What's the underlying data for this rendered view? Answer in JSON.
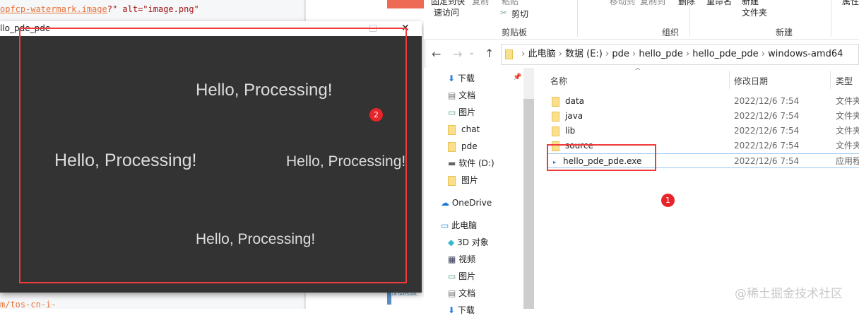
{
  "editor": {
    "line1_link": "opfcp-watermark.image",
    "line1_rest": "?\" alt=\"image.png\"",
    "line2": "m/tos-cn-i-",
    "mini_line_no": "18",
    "mini_code": "textSize("
  },
  "processing_window": {
    "title": "llo_pde_pde",
    "texts": [
      "Hello, Processing!",
      "Hello, Processing!",
      "Hello, Processing!",
      "Hello, Processing!"
    ],
    "badge": "2"
  },
  "ribbon": {
    "top_items": [
      "固定到快",
      "复制",
      "粘贴",
      "移动到",
      "复制到",
      "删除",
      "重命名",
      "新建",
      "属性"
    ],
    "quick_access": "速访问",
    "cut": "剪切",
    "new_folder": "文件夹",
    "groups": [
      "剪贴板",
      "组织",
      "新建"
    ]
  },
  "address": {
    "crumbs": [
      "此电脑",
      "数据 (E:)",
      "pde",
      "hello_pde",
      "hello_pde_pde",
      "windows-amd64"
    ]
  },
  "nav": [
    {
      "label": "下载",
      "icon": "download-icon"
    },
    {
      "label": "文档",
      "icon": "document-icon"
    },
    {
      "label": "图片",
      "icon": "picture-icon"
    },
    {
      "label": "chat",
      "icon": "folder-icon"
    },
    {
      "label": "pde",
      "icon": "folder-icon"
    },
    {
      "label": "软件 (D:)",
      "icon": "drive-icon"
    },
    {
      "label": "图片",
      "icon": "folder-icon"
    },
    {
      "label": "OneDrive",
      "icon": "cloud-icon"
    },
    {
      "label": "此电脑",
      "icon": "computer-icon"
    },
    {
      "label": "3D 对象",
      "icon": "cube-icon"
    },
    {
      "label": "视频",
      "icon": "video-icon"
    },
    {
      "label": "图片",
      "icon": "picture-icon"
    },
    {
      "label": "文档",
      "icon": "document-icon"
    },
    {
      "label": "下载",
      "icon": "download-icon"
    }
  ],
  "columns": {
    "name": "名称",
    "date": "修改日期",
    "type": "类型"
  },
  "files": [
    {
      "name": "data",
      "date": "2022/12/6 7:54",
      "type": "文件夹"
    },
    {
      "name": "java",
      "date": "2022/12/6 7:54",
      "type": "文件夹"
    },
    {
      "name": "lib",
      "date": "2022/12/6 7:54",
      "type": "文件夹"
    },
    {
      "name": "source",
      "date": "2022/12/6 7:54",
      "type": "文件夹"
    },
    {
      "name": "hello_pde_pde.exe",
      "date": "2022/12/6 7:54",
      "type": "应用程序"
    }
  ],
  "badge1": "1",
  "watermark": "@稀土掘金技术社区"
}
